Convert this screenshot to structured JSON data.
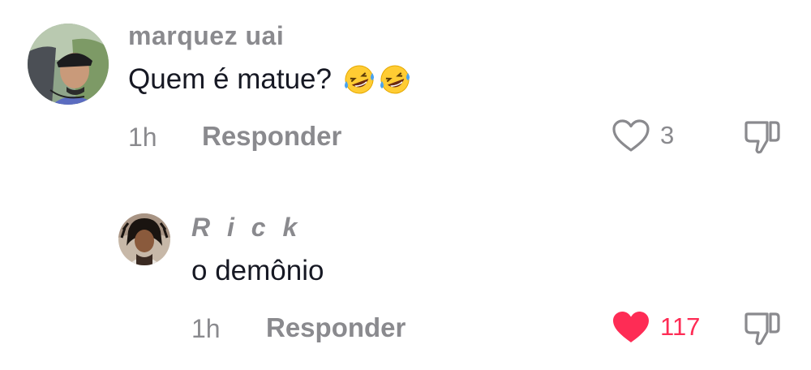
{
  "comment": {
    "username": "marquez uai",
    "text": "Quem é matue?",
    "emojis": [
      "rolling-on-floor-laughing",
      "rolling-on-floor-laughing"
    ],
    "time": "1h",
    "reply_label": "Responder",
    "like_count": "3",
    "liked": false
  },
  "reply": {
    "username": "R i c k",
    "text": "o demônio",
    "time": "1h",
    "reply_label": "Responder",
    "like_count": "117",
    "liked": true
  },
  "colors": {
    "like_active": "#fe2c55",
    "muted_text": "#8a8a8e",
    "primary_text": "#161823"
  },
  "icons": {
    "like": "heart-outline-icon",
    "liked": "heart-filled-icon",
    "dislike": "thumbs-down-icon"
  }
}
